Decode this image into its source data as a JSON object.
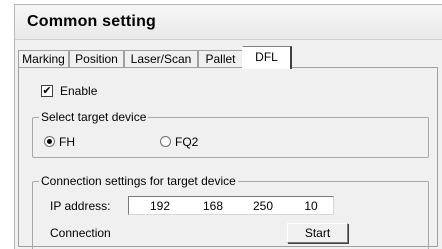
{
  "window": {
    "title": "Common setting"
  },
  "tabs": [
    {
      "label": "Marking"
    },
    {
      "label": "Position"
    },
    {
      "label": "Laser/Scan"
    },
    {
      "label": "Pallet"
    },
    {
      "label": "DFL",
      "active": true
    }
  ],
  "enable": {
    "label": "Enable",
    "checked": true
  },
  "target_device": {
    "legend": "Select target device",
    "options": [
      {
        "label": "FH",
        "selected": true
      },
      {
        "label": "FQ2",
        "selected": false
      }
    ]
  },
  "connection": {
    "legend": "Connection settings for target device",
    "ip_label": "IP address:",
    "ip": [
      "192",
      "168",
      "250",
      "10"
    ],
    "connection_label": "Connection",
    "start_label": "Start"
  }
}
